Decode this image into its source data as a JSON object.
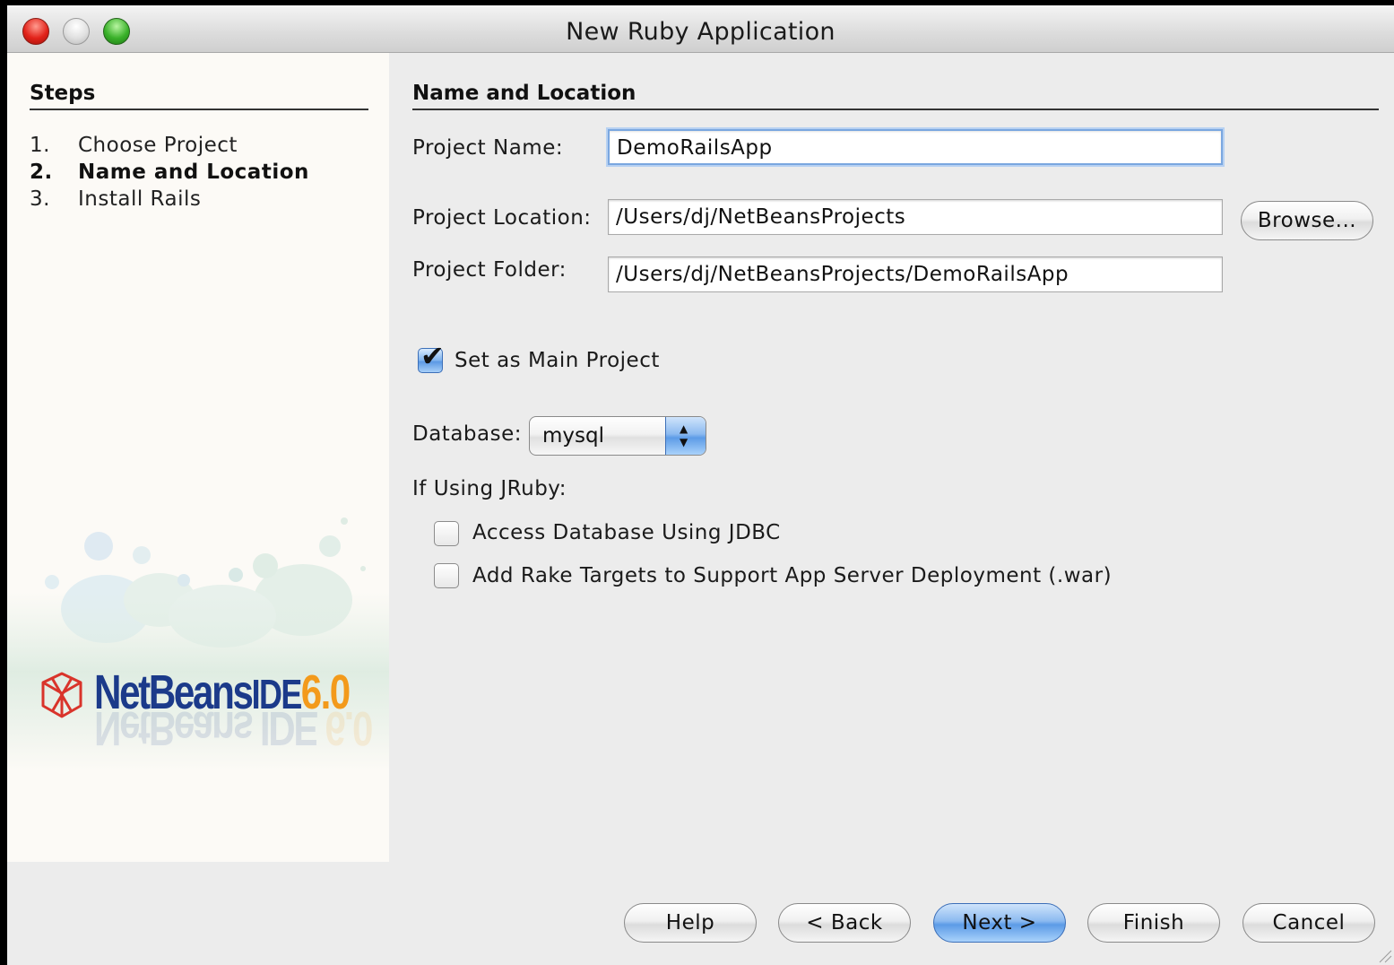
{
  "window": {
    "title": "New Ruby Application"
  },
  "steps": {
    "heading": "Steps",
    "items": [
      {
        "num": "1.",
        "label": "Choose Project"
      },
      {
        "num": "2.",
        "label": "Name and Location"
      },
      {
        "num": "3.",
        "label": "Install Rails"
      }
    ],
    "current": 2
  },
  "logo": {
    "name": "NetBeans",
    "ide": "IDE",
    "version": "6.0",
    "icon": "netbeans-cube-icon"
  },
  "form": {
    "heading": "Name and Location",
    "project_name": {
      "label": "Project Name:",
      "value": "DemoRailsApp"
    },
    "project_location": {
      "label": "Project Location:",
      "value": "/Users/dj/NetBeansProjects",
      "browse_label": "Browse..."
    },
    "project_folder": {
      "label": "Project Folder:",
      "value": "/Users/dj/NetBeansProjects/DemoRailsApp"
    },
    "main_project": {
      "label": "Set as Main Project",
      "checked": true
    },
    "database": {
      "label": "Database:",
      "value": "mysql"
    },
    "jruby_heading": "If Using JRuby:",
    "jdbc": {
      "label": "Access Database Using JDBC",
      "checked": false
    },
    "rake": {
      "label": "Add Rake Targets to Support App Server Deployment (.war)",
      "checked": false
    }
  },
  "buttons": {
    "help": "Help",
    "back": "< Back",
    "next": "Next >",
    "finish": "Finish",
    "cancel": "Cancel"
  },
  "colors": {
    "accent_blue": "#5c9be6",
    "logo_blue": "#1b3a8a",
    "logo_orange": "#f39a1b"
  }
}
